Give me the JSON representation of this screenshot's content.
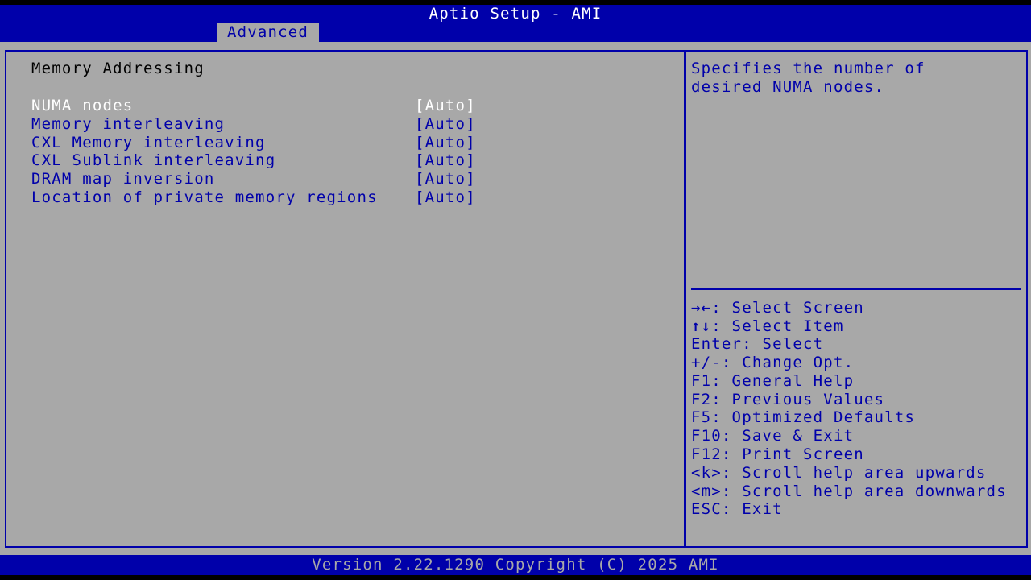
{
  "app": {
    "title": "Aptio Setup - AMI",
    "tabs": [
      {
        "label": "Advanced",
        "active": true
      }
    ],
    "footer": "Version 2.22.1290 Copyright (C) 2025 AMI"
  },
  "main": {
    "section_title": "Memory Addressing",
    "options": [
      {
        "label": "NUMA nodes",
        "value": "[Auto]",
        "selected": true
      },
      {
        "label": "Memory interleaving",
        "value": "[Auto]",
        "selected": false
      },
      {
        "label": "CXL Memory interleaving",
        "value": "[Auto]",
        "selected": false
      },
      {
        "label": "CXL Sublink interleaving",
        "value": "[Auto]",
        "selected": false
      },
      {
        "label": "DRAM map inversion",
        "value": "[Auto]",
        "selected": false
      },
      {
        "label": "Location of private memory regions",
        "value": "[Auto]",
        "selected": false
      }
    ]
  },
  "help": {
    "lines": [
      "Specifies the number of",
      "desired NUMA nodes."
    ]
  },
  "keys": [
    {
      "key": "→←",
      "desc": ": Select Screen"
    },
    {
      "key": "↑↓",
      "desc": ": Select Item"
    },
    {
      "key": "Enter",
      "desc": ": Select"
    },
    {
      "key": "+/-",
      "desc": ": Change Opt."
    },
    {
      "key": "F1",
      "desc": ": General Help"
    },
    {
      "key": "F2",
      "desc": ": Previous Values"
    },
    {
      "key": "F5",
      "desc": ": Optimized Defaults"
    },
    {
      "key": "F10",
      "desc": ": Save & Exit"
    },
    {
      "key": "F12",
      "desc": ": Print Screen"
    },
    {
      "key": "<k>",
      "desc": ": Scroll help area upwards"
    },
    {
      "key": "<m>",
      "desc": ": Scroll help area downwards"
    },
    {
      "key": "ESC",
      "desc": ": Exit"
    }
  ],
  "colors": {
    "background": "#a8a8a8",
    "accent_blue": "#0000aa",
    "selected_text": "#ffffff",
    "screen_border": "#000000"
  }
}
